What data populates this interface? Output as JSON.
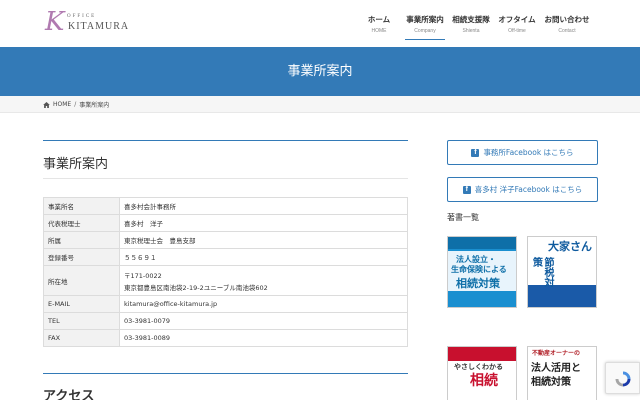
{
  "logo": {
    "letter": "K",
    "office": "OFFICE",
    "name": "KITAMURA"
  },
  "nav": [
    {
      "jp": "ホーム",
      "en": "HOME"
    },
    {
      "jp": "事業所案内",
      "en": "Company"
    },
    {
      "jp": "相続支援隊",
      "en": "Shienta"
    },
    {
      "jp": "オフタイム",
      "en": "Off-time"
    },
    {
      "jp": "お問い合わせ",
      "en": "Contact"
    }
  ],
  "banner": {
    "title": "事業所案内"
  },
  "breadcrumb": {
    "home": "HOME",
    "sep": "/",
    "current": "事業所案内"
  },
  "main": {
    "title": "事業所案内",
    "rows": [
      {
        "key": "事業所名",
        "value": "喜多村会計事務所"
      },
      {
        "key": "代表税理士",
        "value": "喜多村　洋子"
      },
      {
        "key": "所属",
        "value": "東京税理士会　豊島支部"
      },
      {
        "key": "登録番号",
        "value": "５５６９１"
      },
      {
        "key": "所在地",
        "value": "〒171-0022",
        "value2": "東京都豊島区南池袋2-19-2ユニーブル南池袋602"
      },
      {
        "key": "E-MAIL",
        "value": "kitamura@office-kitamura.jp"
      },
      {
        "key": "TEL",
        "value": "03-3981-0079"
      },
      {
        "key": "FAX",
        "value": "03-3981-0089"
      }
    ],
    "access": "アクセス"
  },
  "sidebar": {
    "fb1": "事務所Facebook はこちら",
    "fb2": "喜多村 洋子Facebook はこちら",
    "books_heading": "著書一覧",
    "books": [
      {
        "line1": "法人設立・",
        "line2": "生命保険による",
        "line3": "相続対策"
      },
      {
        "line1": "大家さん",
        "line2": "節税対策",
        "line3": ""
      },
      {
        "line1": "相続",
        "line2": "やさしくわかる",
        "line3": ""
      },
      {
        "line1": "不動産オーナーの",
        "line2": "法人活用と",
        "line3": "相続対策"
      }
    ]
  },
  "colors": {
    "accent": "#337ab7",
    "logo": "#b07ab0"
  }
}
